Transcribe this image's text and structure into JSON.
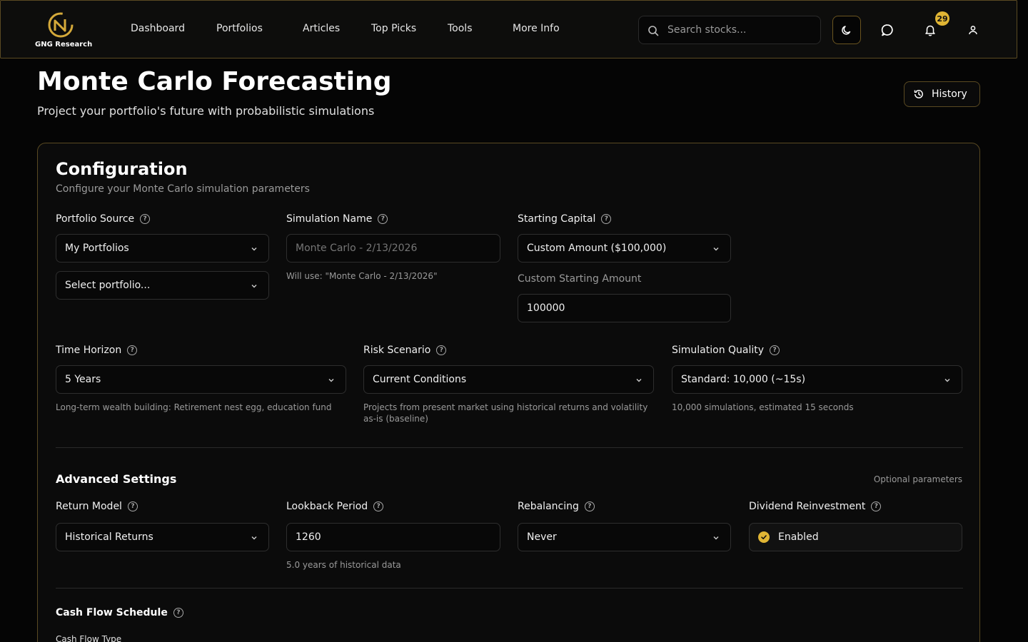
{
  "header": {
    "logo_text": "GNG Research",
    "nav": [
      "Dashboard",
      "Portfolios",
      "Articles",
      "Top Picks",
      "Tools",
      "More Info"
    ],
    "search_placeholder": "Search stocks...",
    "notification_count": "29",
    "accent_color": "#e0b534"
  },
  "page": {
    "title": "Monte Carlo Forecasting",
    "subtitle": "Project your portfolio's future with probabilistic simulations",
    "history_label": "History"
  },
  "config": {
    "title": "Configuration",
    "subtitle": "Configure your Monte Carlo simulation parameters",
    "portfolio_source": {
      "label": "Portfolio Source",
      "value": "My Portfolios",
      "select_value": "Select portfolio..."
    },
    "simulation_name": {
      "label": "Simulation Name",
      "placeholder": "Monte Carlo - 2/13/2026",
      "hint": "Will use: \"Monte Carlo - 2/13/2026\""
    },
    "starting_capital": {
      "label": "Starting Capital",
      "value": "Custom Amount ($100,000)",
      "custom_label": "Custom Starting Amount",
      "custom_value": "100000"
    },
    "time_horizon": {
      "label": "Time Horizon",
      "value": "5 Years",
      "hint": "Long-term wealth building: Retirement nest egg, education fund"
    },
    "risk_scenario": {
      "label": "Risk Scenario",
      "value": "Current Conditions",
      "hint_line1": "Projects from present market using historical returns and volatility",
      "hint_line2": "as-is (baseline)"
    },
    "simulation_quality": {
      "label": "Simulation Quality",
      "value": "Standard: 10,000 (~15s)",
      "hint": "10,000 simulations, estimated 15 seconds"
    }
  },
  "advanced": {
    "title": "Advanced Settings",
    "optional_label": "Optional parameters",
    "return_model": {
      "label": "Return Model",
      "value": "Historical Returns"
    },
    "lookback_period": {
      "label": "Lookback Period",
      "value": "1260",
      "hint": "5.0 years of historical data"
    },
    "rebalancing": {
      "label": "Rebalancing",
      "value": "Never"
    },
    "dividend_reinvestment": {
      "label": "Dividend Reinvestment",
      "value": "Enabled"
    }
  },
  "cash_flow": {
    "title": "Cash Flow Schedule",
    "type_label": "Cash Flow Type"
  }
}
